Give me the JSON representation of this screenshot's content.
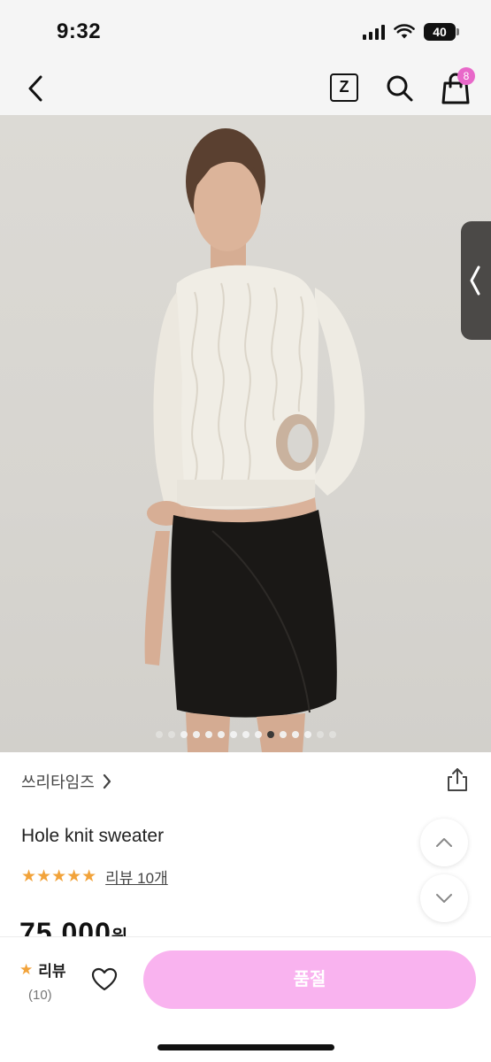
{
  "status_bar": {
    "time": "9:32",
    "battery": "40",
    "icons": [
      "signal-icon",
      "wifi-icon",
      "battery-icon"
    ]
  },
  "nav": {
    "icons": [
      "back-chevron-icon",
      "z-icon",
      "search-icon",
      "shopping-bag-icon"
    ],
    "z_label": "Z",
    "cart_count": "8"
  },
  "gallery": {
    "image": "model wearing cream cable knit cropped sweater with side cutout and black wrap mini skirt",
    "side_tab_icon": "chevron-left-icon"
  },
  "product": {
    "brand": "쓰리타임즈",
    "name": "Hole knit sweater",
    "rating_stars": 5,
    "review_link": "리뷰 10개",
    "price": "75,000",
    "price_unit": "원"
  },
  "bottom_bar": {
    "review_label": "리뷰",
    "review_count": "(10)",
    "soldout_label": "품절"
  },
  "colors": {
    "accent": "#f9b3ef",
    "badge": "#e868c9",
    "star": "#f2a33a"
  }
}
